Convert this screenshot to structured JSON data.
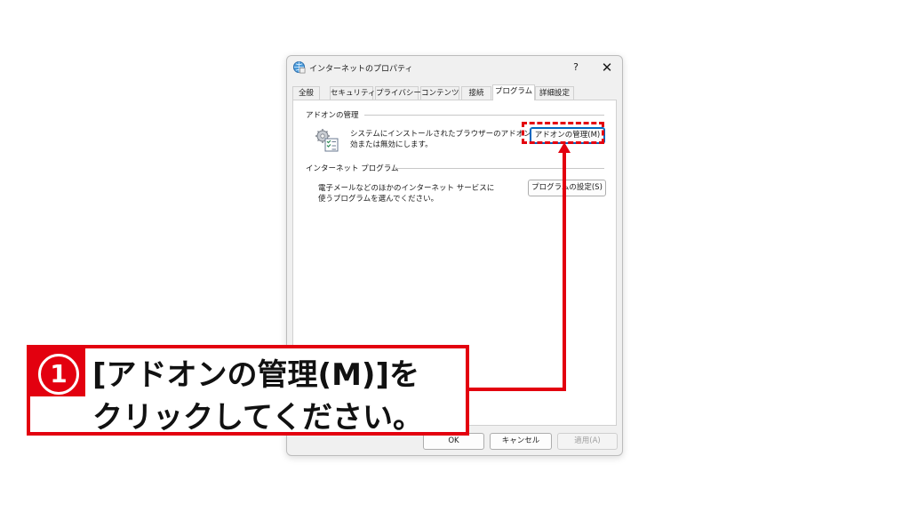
{
  "window": {
    "title": "インターネットのプロパティ",
    "help_label": "?",
    "close_label": "✕"
  },
  "tabs": [
    {
      "label": "全般"
    },
    {
      "label": "セキュリティ"
    },
    {
      "label": "プライバシー"
    },
    {
      "label": "コンテンツ"
    },
    {
      "label": "接続"
    },
    {
      "label": "プログラム",
      "active": true
    },
    {
      "label": "詳細設定"
    }
  ],
  "addons": {
    "group_label": "アドオンの管理",
    "description_line1": "システムにインストールされたブラウザーのアドオンを有",
    "description_line2": "効または無効にします。",
    "button_label": "アドオンの管理(M)"
  },
  "internet_programs": {
    "group_label": "インターネット プログラム",
    "description_line1": "電子メールなどのほかのインターネット サービスに",
    "description_line2": "使うプログラムを選んでください。",
    "button_label": "プログラムの設定(S)"
  },
  "footer": {
    "ok_label": "OK",
    "cancel_label": "キャンセル",
    "apply_label": "適用(A)"
  },
  "annotation": {
    "step_number": "1",
    "line1": "[アドオンの管理(M)]を",
    "line2": "クリックしてください。",
    "accent_color": "#e3000f"
  }
}
